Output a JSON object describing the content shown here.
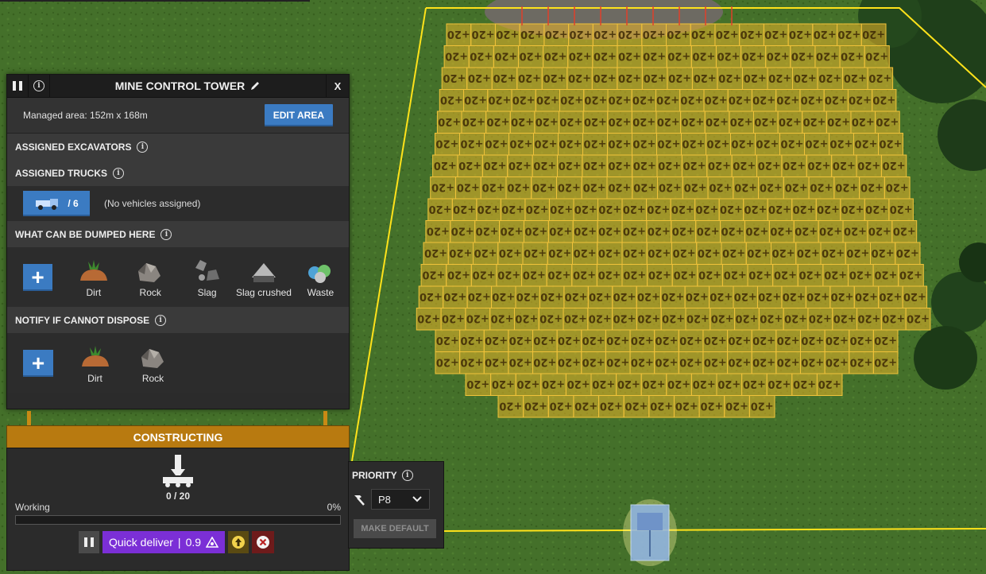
{
  "panel": {
    "title": "MINE CONTROL TOWER",
    "close_label": "X",
    "managed_area": "Managed area: 152m x 168m",
    "edit_area_label": "EDIT AREA",
    "assigned_excavators_label": "ASSIGNED EXCAVATORS",
    "assigned_trucks_label": "ASSIGNED TRUCKS",
    "trucks_count": "/ 6",
    "no_vehicles": "(No vehicles assigned)",
    "dump_section_label": "WHAT CAN BE DUMPED HERE",
    "dump_products": [
      {
        "label": "Dirt",
        "icon": "dirt-icon"
      },
      {
        "label": "Rock",
        "icon": "rock-icon"
      },
      {
        "label": "Slag",
        "icon": "slag-icon"
      },
      {
        "label": "Slag crushed",
        "icon": "slag-crushed-icon"
      },
      {
        "label": "Waste",
        "icon": "waste-icon"
      }
    ],
    "notify_section_label": "NOTIFY IF CANNOT DISPOSE",
    "notify_products": [
      {
        "label": "Dirt",
        "icon": "dirt-icon"
      },
      {
        "label": "Rock",
        "icon": "rock-icon"
      }
    ]
  },
  "construction": {
    "status_label": "CONSTRUCTING",
    "count": "0 / 20",
    "working_label": "Working",
    "percent_label": "0%",
    "progress_fraction": 0.0,
    "quick_deliver_label": "Quick deliver",
    "quick_deliver_cost": "0.9"
  },
  "priority": {
    "label": "PRIORITY",
    "value": "P8",
    "make_default_label": "MAKE DEFAULT"
  },
  "grid": {
    "tile_label": "+20"
  },
  "colors": {
    "grass": "#3f6a23",
    "accent_blue": "#3b7bc2",
    "construct_orange": "#b87a10",
    "quick_purple": "#7b2fd6",
    "area_outline": "#ffe21a"
  }
}
